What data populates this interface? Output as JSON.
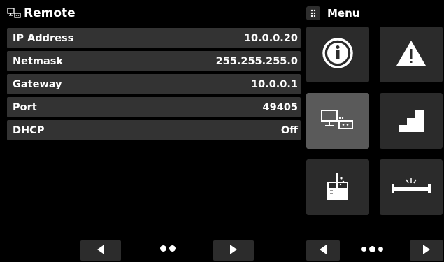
{
  "remote": {
    "title": "Remote",
    "icon": "remote-network-icon",
    "rows": [
      {
        "label": "IP Address",
        "value": "10.0.0.20"
      },
      {
        "label": "Netmask",
        "value": "255.255.255.0"
      },
      {
        "label": "Gateway",
        "value": "10.0.0.1"
      },
      {
        "label": "Port",
        "value": "49405"
      },
      {
        "label": "DHCP",
        "value": "Off"
      }
    ]
  },
  "menu": {
    "title": "Menu",
    "icon": "grid-dots-icon",
    "tiles": [
      {
        "name": "info",
        "icon": "info-icon"
      },
      {
        "name": "warning",
        "icon": "warning-icon"
      },
      {
        "name": "remote",
        "icon": "remote-network-icon",
        "selected": true
      },
      {
        "name": "steps",
        "icon": "steps-icon"
      },
      {
        "name": "lab",
        "icon": "beaker-icon"
      },
      {
        "name": "leak",
        "icon": "leak-test-icon"
      }
    ]
  },
  "nav": {
    "left_page_dots": 2,
    "right_page_dots": 3,
    "prev_icon": "arrow-left-icon",
    "next_icon": "arrow-right-icon"
  },
  "colors": {
    "background": "#000000",
    "row_bg": "#333333",
    "tile_bg": "#2b2b2b",
    "tile_selected_bg": "#5a5a5a",
    "text": "#ffffff"
  }
}
